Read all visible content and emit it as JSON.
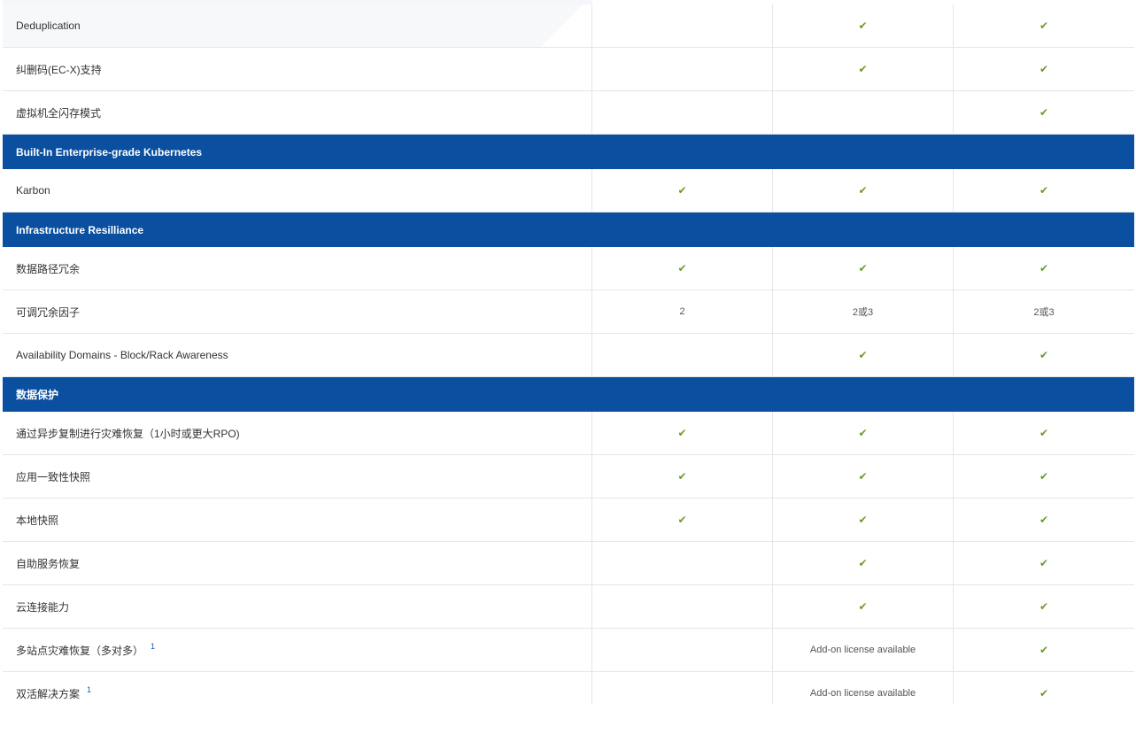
{
  "check_icon": "check-icon",
  "accent_color": "#0a4fa0",
  "check_color": "#6d9a2a",
  "rows": [
    {
      "type": "row",
      "label": "Deduplication",
      "cols": [
        "",
        "✔",
        "✔"
      ]
    },
    {
      "type": "row",
      "label": "纠删码(EC-X)支持",
      "cols": [
        "",
        "✔",
        "✔"
      ]
    },
    {
      "type": "row",
      "label": "虚拟机全闪存模式",
      "cols": [
        "",
        "",
        "✔"
      ]
    },
    {
      "type": "section",
      "label": "Built-In Enterprise-grade Kubernetes"
    },
    {
      "type": "row",
      "label": "Karbon",
      "cols": [
        "✔",
        "✔",
        "✔"
      ]
    },
    {
      "type": "section",
      "label": "Infrastructure Resilliance"
    },
    {
      "type": "row",
      "label": "数据路径冗余",
      "cols": [
        "✔",
        "✔",
        "✔"
      ]
    },
    {
      "type": "row",
      "label": "可调冗余因子",
      "cols": [
        "2",
        "2或3",
        "2或3"
      ]
    },
    {
      "type": "row",
      "label": "Availability Domains - Block/Rack Awareness",
      "cols": [
        "",
        "✔",
        "✔"
      ]
    },
    {
      "type": "section",
      "label": "数据保护"
    },
    {
      "type": "row",
      "label": "通过异步复制进行灾难恢复（1小时或更大RPO)",
      "cols": [
        "✔",
        "✔",
        "✔"
      ]
    },
    {
      "type": "row",
      "label": "应用一致性快照",
      "cols": [
        "✔",
        "✔",
        "✔"
      ]
    },
    {
      "type": "row",
      "label": "本地快照",
      "cols": [
        "✔",
        "✔",
        "✔"
      ]
    },
    {
      "type": "row",
      "label": "自助服务恢复",
      "cols": [
        "",
        "✔",
        "✔"
      ]
    },
    {
      "type": "row",
      "label": "云连接能力",
      "cols": [
        "",
        "✔",
        "✔"
      ]
    },
    {
      "type": "row",
      "label": "多站点灾难恢复（多对多）",
      "footnote": "1",
      "cols": [
        "",
        "Add-on license available",
        "✔"
      ]
    },
    {
      "type": "row",
      "label": "双活解决方案",
      "footnote": "1",
      "cols": [
        "",
        "Add-on license available",
        "✔"
      ]
    }
  ]
}
